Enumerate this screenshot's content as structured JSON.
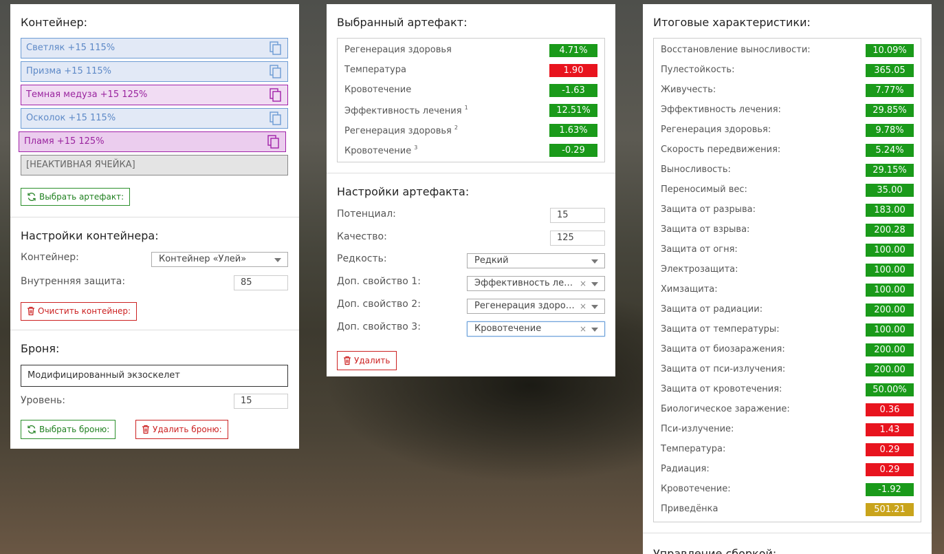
{
  "container": {
    "title": "Контейнер:",
    "slots": [
      {
        "label": "Светляк +15 115%",
        "color": "#5d89c7"
      },
      {
        "label": "Призма +15 115%",
        "color": "#5d89c7"
      },
      {
        "label": "Темная медуза +15 125%",
        "color": "#9a259f"
      },
      {
        "label": "Осколок +15 115%",
        "color": "#5d89c7"
      },
      {
        "label": "Пламя +15 125%",
        "color": "#9a259f"
      },
      {
        "label": "[НЕАКТИВНАЯ ЯЧЕЙКА]",
        "color": "#666666"
      }
    ],
    "choose_artifact_label": "Выбрать артефакт:"
  },
  "container_settings": {
    "title": "Настройки контейнера:",
    "container_label": "Контейнер:",
    "container_value": "Контейнер «Улей»",
    "inner_protection_label": "Внутренняя защита:",
    "inner_protection_value": "85",
    "clear_label": "Очистить контейнер:"
  },
  "armor": {
    "title": "Броня:",
    "armor_name": "Модифицированный экзоскелет",
    "level_label": "Уровень:",
    "level_value": "15",
    "choose_label": "Выбрать броню:",
    "delete_label": "Удалить броню:"
  },
  "selected_artifact": {
    "title": "Выбранный артефакт:",
    "stats": [
      {
        "name": "Регенерация здоровья",
        "sup": "",
        "value": "4.71%",
        "tone": "green"
      },
      {
        "name": "Температура",
        "sup": "",
        "value": "1.90",
        "tone": "red"
      },
      {
        "name": "Кровотечение",
        "sup": "",
        "value": "-1.63",
        "tone": "green"
      },
      {
        "name": "Эффективность лечения",
        "sup": "1",
        "value": "12.51%",
        "tone": "green"
      },
      {
        "name": "Регенерация здоровья",
        "sup": "2",
        "value": "1.63%",
        "tone": "green"
      },
      {
        "name": "Кровотечение",
        "sup": "3",
        "value": "-0.29",
        "tone": "green"
      }
    ]
  },
  "artifact_settings": {
    "title": "Настройки артефакта:",
    "potential_label": "Потенциал:",
    "potential_value": "15",
    "quality_label": "Качество:",
    "quality_value": "125",
    "rarity_label": "Редкость:",
    "rarity_value": "Редкий",
    "prop1_label": "Доп. свойство 1:",
    "prop1_value": "Эффективность лечения",
    "prop2_label": "Доп. свойство 2:",
    "prop2_value": "Регенерация здоровья",
    "prop3_label": "Доп. свойство 3:",
    "prop3_value": "Кровотечение",
    "clear_glyph": "×",
    "delete_label": "Удалить"
  },
  "totals": {
    "title": "Итоговые характеристики:",
    "stats": [
      {
        "name": "Восстановление выносливости:",
        "value": "10.09%",
        "tone": "green"
      },
      {
        "name": "Пулестойкость:",
        "value": "365.05",
        "tone": "green"
      },
      {
        "name": "Живучесть:",
        "value": "7.77%",
        "tone": "green"
      },
      {
        "name": "Эффективность лечения:",
        "value": "29.85%",
        "tone": "green"
      },
      {
        "name": "Регенерация здоровья:",
        "value": "9.78%",
        "tone": "green"
      },
      {
        "name": "Скорость передвижения:",
        "value": "5.24%",
        "tone": "green"
      },
      {
        "name": "Выносливость:",
        "value": "29.15%",
        "tone": "green"
      },
      {
        "name": "Переносимый вес:",
        "value": "35.00",
        "tone": "green"
      },
      {
        "name": "Защита от разрыва:",
        "value": "183.00",
        "tone": "green"
      },
      {
        "name": "Защита от взрыва:",
        "value": "200.28",
        "tone": "green"
      },
      {
        "name": "Защита от огня:",
        "value": "100.00",
        "tone": "green"
      },
      {
        "name": "Электрозащита:",
        "value": "100.00",
        "tone": "green"
      },
      {
        "name": "Химзащита:",
        "value": "100.00",
        "tone": "green"
      },
      {
        "name": "Защита от радиации:",
        "value": "200.00",
        "tone": "green"
      },
      {
        "name": "Защита от температуры:",
        "value": "100.00",
        "tone": "green"
      },
      {
        "name": "Защита от биозаражения:",
        "value": "200.00",
        "tone": "green"
      },
      {
        "name": "Защита от пси-излучения:",
        "value": "200.00",
        "tone": "green"
      },
      {
        "name": "Защита от кровотечения:",
        "value": "50.00%",
        "tone": "green"
      },
      {
        "name": "Биологическое заражение:",
        "value": "0.36",
        "tone": "red"
      },
      {
        "name": "Пси-излучение:",
        "value": "1.43",
        "tone": "red"
      },
      {
        "name": "Температура:",
        "value": "0.29",
        "tone": "red"
      },
      {
        "name": "Радиация:",
        "value": "0.29",
        "tone": "red"
      },
      {
        "name": "Кровотечение:",
        "value": "-1.92",
        "tone": "green"
      },
      {
        "name": "Приведёнка",
        "value": "501.21",
        "tone": "gold"
      }
    ],
    "build_title": "Управление сборкой:"
  },
  "colors": {
    "positive": "#1a9a1a",
    "negative": "#e8141e",
    "summary": "#c9a41c",
    "button_green": "#208020",
    "button_red": "#cc2020"
  },
  "icons": {
    "slot": "clipboard-icon",
    "choose": "refresh-icon",
    "delete": "trash-icon",
    "dropdown": "chevron-down-icon"
  }
}
